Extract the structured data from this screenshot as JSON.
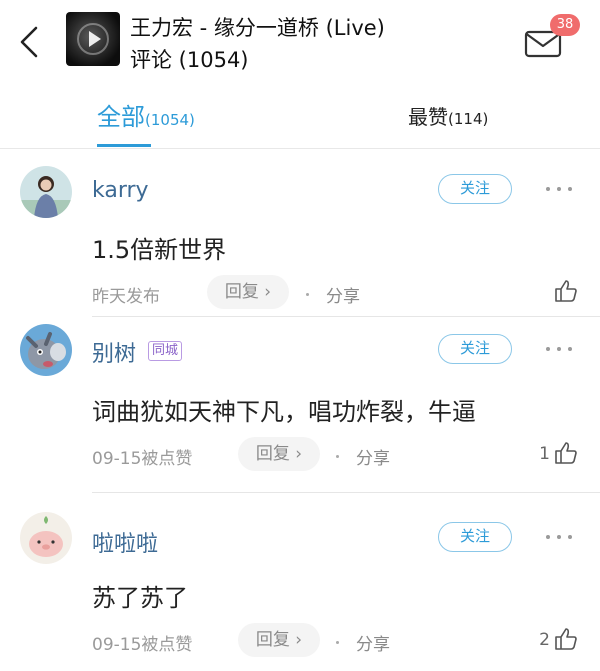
{
  "header": {
    "song_title": "王力宏 - 缘分一道桥 (Live)",
    "subtitle": "评论 (1054)",
    "mail_badge": "38"
  },
  "tabs": {
    "all_label": "全部",
    "all_count": "(1054)",
    "hot_label": "最赞",
    "hot_count": "(114)"
  },
  "follow_label": "关注",
  "reply_label": "回复 ›",
  "share_label": "分享",
  "comments": [
    {
      "user": "karry",
      "text": "1.5倍新世界",
      "meta": "昨天发布",
      "likes": ""
    },
    {
      "user": "别树",
      "badge": "同城",
      "text": "词曲犹如天神下凡，唱功炸裂，牛逼",
      "meta": "09-15被点赞",
      "likes": "1"
    },
    {
      "user": "啦啦啦",
      "text": "苏了苏了",
      "meta": "09-15被点赞",
      "likes": "2"
    }
  ]
}
